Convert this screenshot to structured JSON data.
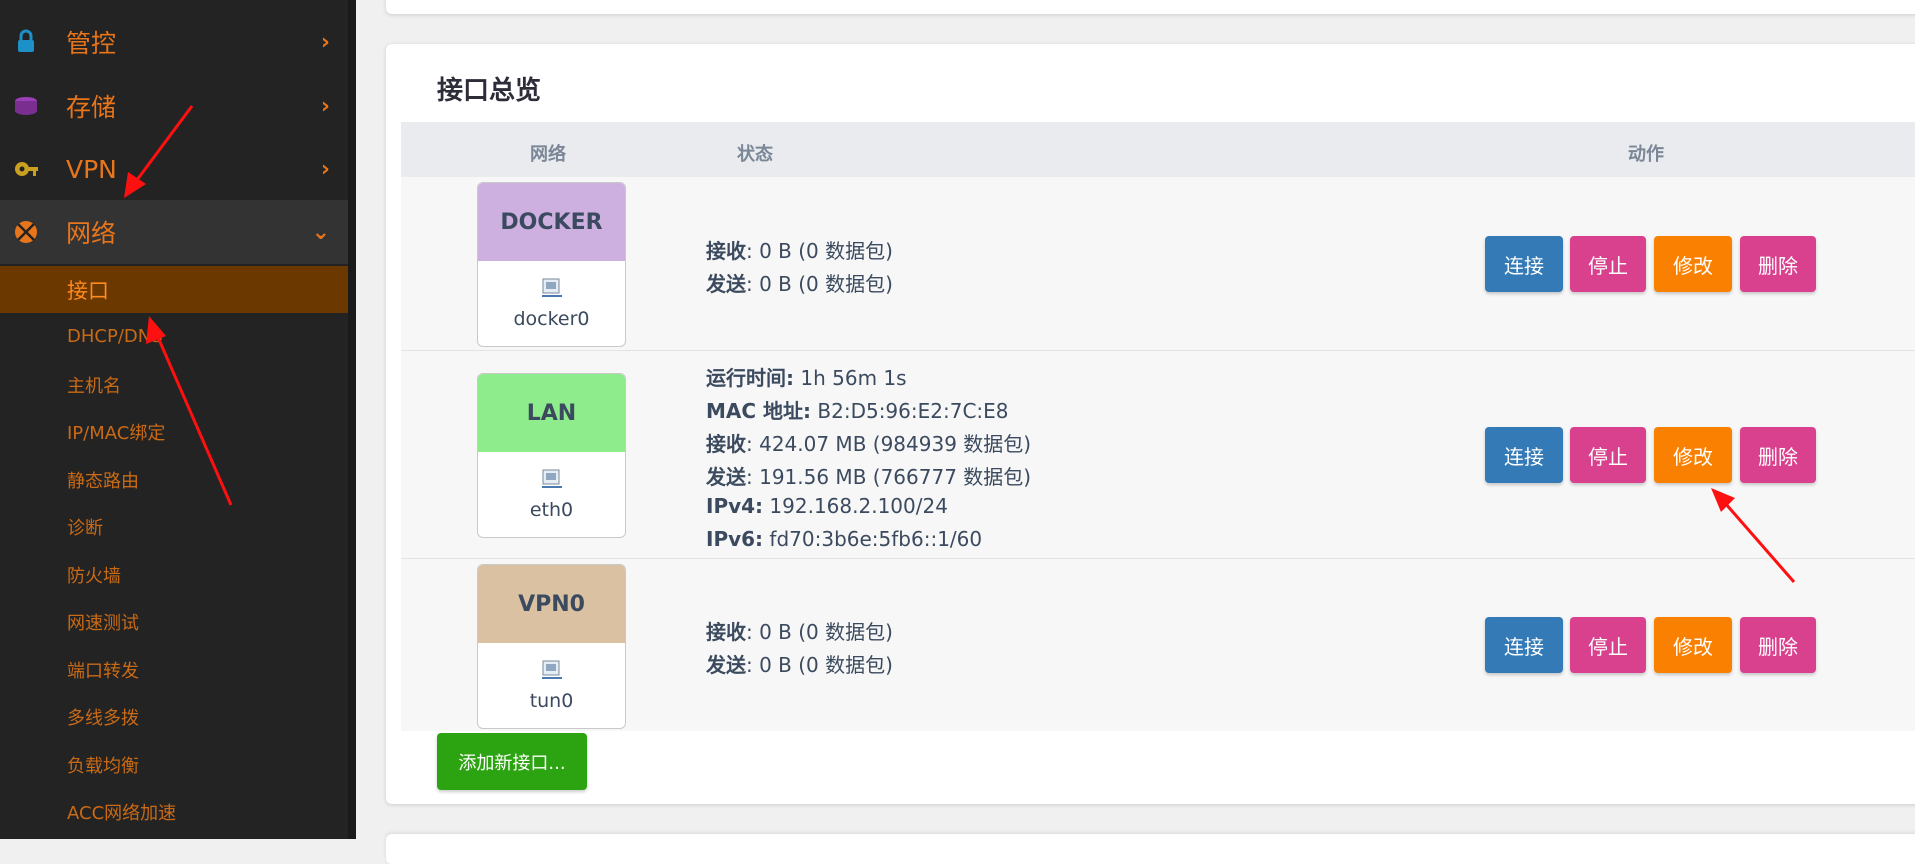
{
  "sidebar": {
    "menu": [
      {
        "label": "管控",
        "icon": "lock-icon",
        "icon_color": "#1e90c8"
      },
      {
        "label": "存储",
        "icon": "disk-icon",
        "icon_color": "#9b3fb6"
      },
      {
        "label": "VPN",
        "icon": "key-icon",
        "icon_color": "#c9a020"
      },
      {
        "label": "网络",
        "icon": "network-icon",
        "icon_color": "#e8751a"
      }
    ],
    "submenu": [
      "接口",
      "DHCP/DNS",
      "主机名",
      "IP/MAC绑定",
      "静态路由",
      "诊断",
      "防火墙",
      "网速测试",
      "端口转发",
      "多线多拨",
      "负载均衡",
      "ACC网络加速"
    ]
  },
  "card": {
    "title": "接口总览",
    "headers": {
      "network": "网络",
      "status": "状态",
      "actions": "动作"
    }
  },
  "interfaces": [
    {
      "name": "DOCKER",
      "device": "docker0",
      "color": "#cdb0e0",
      "status": [
        {
          "label": "接收",
          "value": ": 0 B (0 数据包)"
        },
        {
          "label": "发送",
          "value": ": 0 B (0 数据包)"
        }
      ]
    },
    {
      "name": "LAN",
      "device": "eth0",
      "color": "#8fec8c",
      "status": [
        {
          "label": "运行时间:",
          "value": " 1h 56m 1s"
        },
        {
          "label": "MAC 地址:",
          "value": " B2:D5:96:E2:7C:E8"
        },
        {
          "label": "接收",
          "value": ": 424.07 MB (984939 数据包)"
        },
        {
          "label": "发送",
          "value": ": 191.56 MB (766777 数据包)"
        },
        {
          "label": "IPv4:",
          "value": " 192.168.2.100/24"
        },
        {
          "label": "IPv6:",
          "value": " fd70:3b6e:5fb6::1/60"
        }
      ]
    },
    {
      "name": "VPN0",
      "device": "tun0",
      "color": "#d9c1a1",
      "status": [
        {
          "label": "接收",
          "value": ": 0 B (0 数据包)"
        },
        {
          "label": "发送",
          "value": ": 0 B (0 数据包)"
        }
      ]
    }
  ],
  "buttons": {
    "connect": "连接",
    "stop": "停止",
    "edit": "修改",
    "delete": "删除",
    "add": "添加新接口..."
  }
}
